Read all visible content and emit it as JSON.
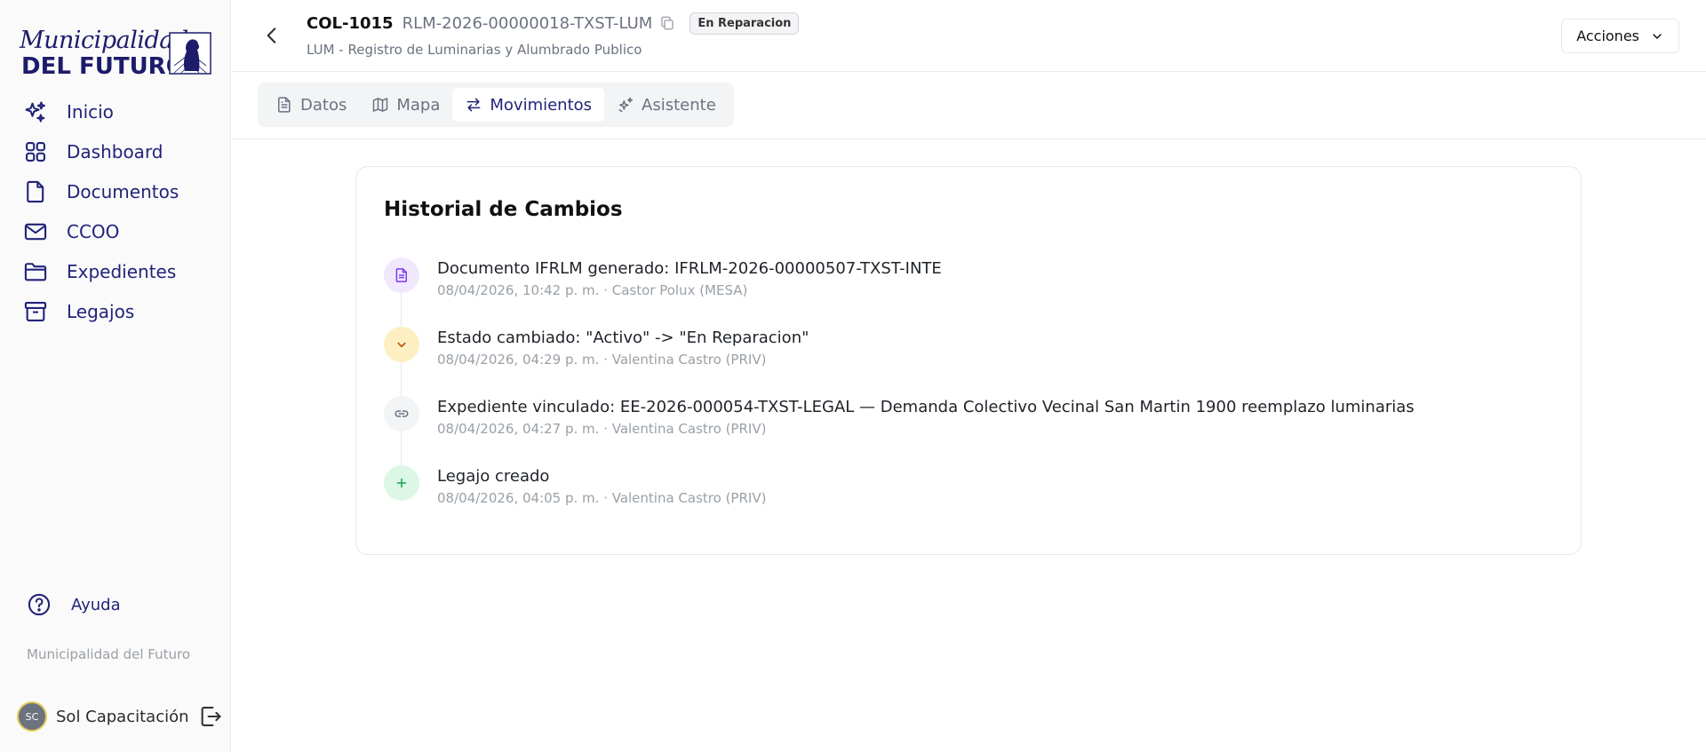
{
  "brand": {
    "logo_script": "Municipalidad",
    "logo_block": "DEL FUTURO",
    "colors": {
      "primary": "#22237a",
      "accent_purple": "#7c3aed",
      "accent_yellow": "#d97706",
      "accent_green": "#16a34a"
    }
  },
  "sidebar": {
    "items": [
      {
        "label": "Inicio",
        "icon": "sparkles-icon"
      },
      {
        "label": "Dashboard",
        "icon": "grid-icon"
      },
      {
        "label": "Documentos",
        "icon": "file-icon"
      },
      {
        "label": "CCOO",
        "icon": "mail-icon"
      },
      {
        "label": "Expedientes",
        "icon": "folder-icon"
      },
      {
        "label": "Legajos",
        "icon": "archive-icon"
      }
    ],
    "help_label": "Ayuda",
    "org_name": "Municipalidad del Futuro",
    "user": {
      "initials": "SC",
      "name": "Sol Capacitación"
    }
  },
  "header": {
    "code": "COL-1015",
    "reference": "RLM-2026-00000018-TXST-LUM",
    "status": "En Reparacion",
    "subtitle": "LUM - Registro de Luminarias y Alumbrado Publico",
    "actions_label": "Acciones"
  },
  "tabs": [
    {
      "label": "Datos",
      "icon": "document-icon",
      "active": false
    },
    {
      "label": "Mapa",
      "icon": "map-icon",
      "active": false
    },
    {
      "label": "Movimientos",
      "icon": "arrows-swap-icon",
      "active": true
    },
    {
      "label": "Asistente",
      "icon": "sparkles-icon",
      "active": false
    }
  ],
  "history": {
    "title": "Historial de Cambios",
    "events": [
      {
        "title": "Documento IFRLM generado: IFRLM-2026-00000507-TXST-INTE",
        "meta": "08/04/2026, 10:42 p. m. · Castor Polux (MESA)",
        "icon": "document-icon"
      },
      {
        "title": "Estado cambiado: \"Activo\" -> \"En Reparacion\"",
        "meta": "08/04/2026, 04:29 p. m. · Valentina Castro (PRIV)",
        "icon": "chevron-down-icon"
      },
      {
        "title": "Expediente vinculado: EE-2026-000054-TXST-LEGAL — Demanda Colectivo Vecinal San Martin 1900 reemplazo luminarias",
        "meta": "08/04/2026, 04:27 p. m. · Valentina Castro (PRIV)",
        "icon": "link-icon"
      },
      {
        "title": "Legajo creado",
        "meta": "08/04/2026, 04:05 p. m. · Valentina Castro (PRIV)",
        "icon": "plus-icon"
      }
    ]
  }
}
